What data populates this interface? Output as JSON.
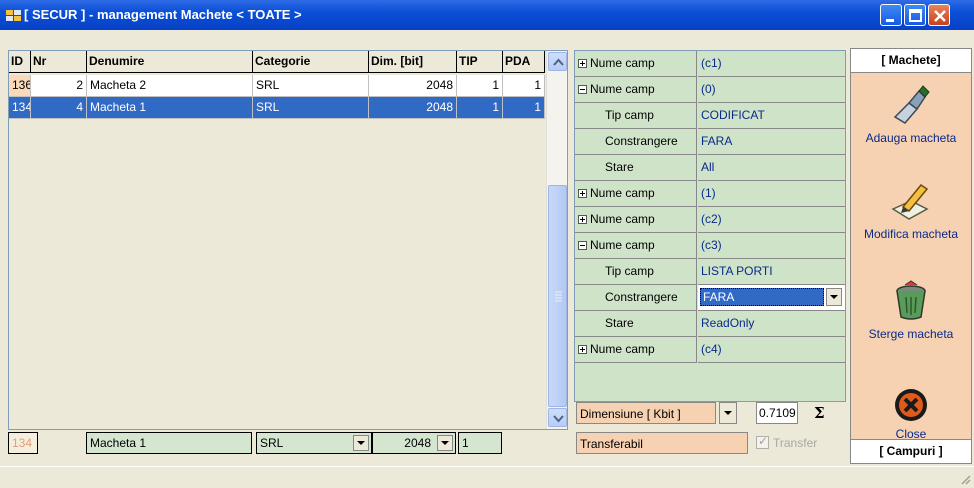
{
  "window": {
    "title": "[ SECUR ] - management Machete < TOATE >"
  },
  "grid": {
    "columns": [
      "ID",
      "Nr",
      "Denumire",
      "Categorie",
      "Dim. [bit]",
      "TIP",
      "PDA"
    ],
    "rows": [
      {
        "id": "136",
        "nr": "2",
        "denumire": "Macheta 2",
        "categorie": "SRL",
        "dim": "2048",
        "tip": "1",
        "pda": "1"
      },
      {
        "id": "134",
        "nr": "4",
        "denumire": "Macheta 1",
        "categorie": "SRL",
        "dim": "2048",
        "tip": "1",
        "pda": "1"
      }
    ]
  },
  "editor": {
    "id": "134",
    "denumire": "Macheta 1",
    "categorie": "SRL",
    "dim": "2048",
    "tip": "1"
  },
  "properties": [
    {
      "name": "Nume camp",
      "value": "(c1)",
      "expander": "plus"
    },
    {
      "name": "Nume camp",
      "value": "(0)",
      "expander": "minus"
    },
    {
      "name": "Tip camp",
      "value": "CODIFICAT",
      "child": true
    },
    {
      "name": "Constrangere",
      "value": "FARA",
      "child": true
    },
    {
      "name": "Stare",
      "value": "All",
      "child": true
    },
    {
      "name": "Nume camp",
      "value": "(1)",
      "expander": "plus"
    },
    {
      "name": "Nume camp",
      "value": "(c2)",
      "expander": "plus"
    },
    {
      "name": "Nume camp",
      "value": "(c3)",
      "expander": "minus"
    },
    {
      "name": "Tip camp",
      "value": "LISTA PORTI",
      "child": true
    },
    {
      "name": "Constrangere",
      "value": "FARA",
      "child": true,
      "dropdown": true
    },
    {
      "name": "Stare",
      "value": "ReadOnly",
      "child": true
    },
    {
      "name": "Nume camp",
      "value": "(c4)",
      "expander": "plus"
    }
  ],
  "dimension": {
    "label": "Dimensiune [ Kbit  ]",
    "value": "0.7109",
    "sum_symbol": "Σ"
  },
  "transfer": {
    "label": "Transferabil",
    "checkbox_label": "Transfer",
    "checked": true,
    "enabled": false
  },
  "sidebar": {
    "header": "[ Machete]",
    "footer": "[ Campuri ]",
    "actions": [
      {
        "label": "Adauga macheta",
        "icon": "add-template-icon"
      },
      {
        "label": "Modifica macheta",
        "icon": "edit-template-icon"
      },
      {
        "label": "Sterge macheta",
        "icon": "trash-icon"
      },
      {
        "label": "Close",
        "icon": "close-circle-icon"
      }
    ]
  },
  "colors": {
    "title_bar": "#0A4FD6",
    "selection": "#316AC5",
    "property_bg": "#CFE3C9",
    "sidebar_bg": "#F6D2B2",
    "value_text": "#0A2A8A"
  }
}
